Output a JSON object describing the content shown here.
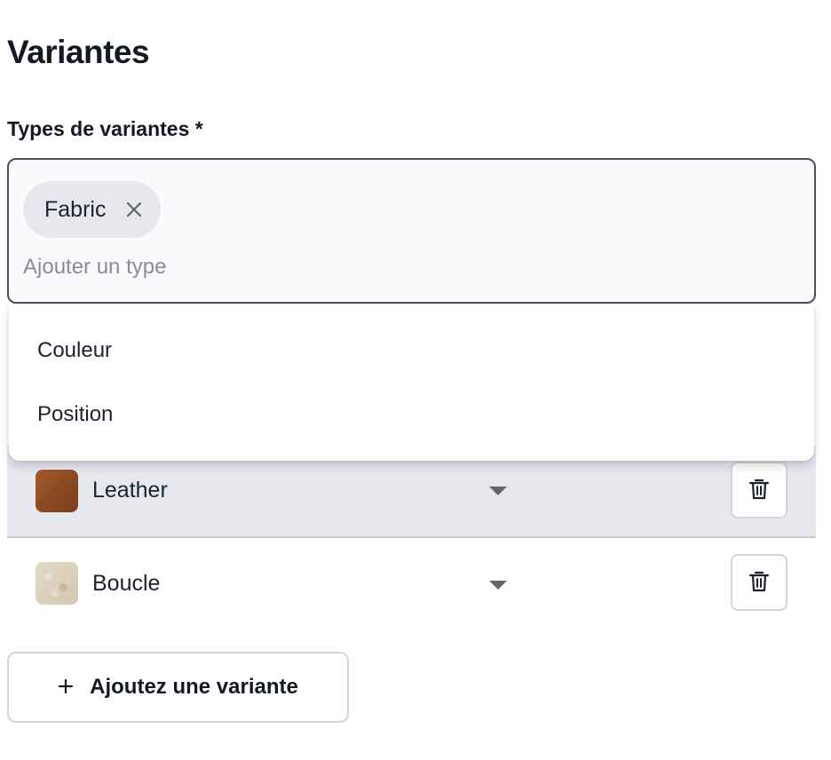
{
  "section": {
    "title": "Variantes",
    "field_label": "Types de variantes *"
  },
  "type_selector": {
    "selected_chips": [
      {
        "label": "Fabric",
        "remove_icon": "close-icon"
      }
    ],
    "input": {
      "value": "",
      "placeholder": "Ajouter un type"
    },
    "dropdown_options": [
      "Couleur",
      "Position"
    ]
  },
  "variants": [
    {
      "name": "Leather",
      "swatch_color": "#9a5228",
      "caret_icon": "caret-down-icon",
      "delete_icon": "trash-icon"
    },
    {
      "name": "Boucle",
      "swatch_color": "#dcd2bd",
      "caret_icon": "caret-down-icon",
      "delete_icon": "trash-icon"
    }
  ],
  "add_button": {
    "label": "Ajoutez une variante",
    "icon": "plus-icon"
  },
  "colors": {
    "text": "#141824",
    "border": "#4b5060",
    "chip_bg": "#e7e7ee",
    "highlight_row": "#e7e7ee"
  }
}
